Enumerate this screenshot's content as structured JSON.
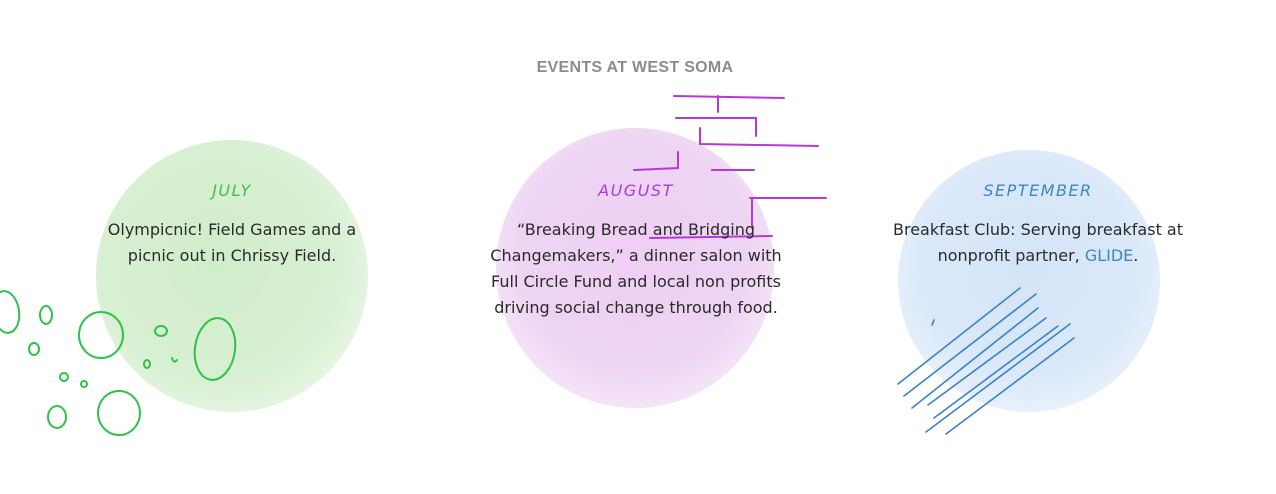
{
  "section": {
    "heading": "EVENTS AT WEST SOMA"
  },
  "events": [
    {
      "month": "JULY",
      "description": "Olympicnic! Field Games and a picnic out in Chrissy Field.",
      "accent_color": "#3cbf4f"
    },
    {
      "month": "AUGUST",
      "description": "“Breaking Bread and Bridging Changemakers,” a dinner salon with Full Circle Fund and local non profits driving social change through food.",
      "accent_color": "#a93fd0"
    },
    {
      "month": "SEPTEMBER",
      "description_before": "Breakfast Club: Serving breakfast at nonprofit partner, ",
      "link_text": "GLIDE",
      "description_after": ".",
      "accent_color": "#3d86c6"
    }
  ],
  "colors": {
    "heading": "#8c8c8c",
    "text": "#2a2a2a",
    "green_blob": "#d4eecd",
    "purple_blob": "#ecd0f2",
    "blue_blob": "#d6e6f8"
  }
}
